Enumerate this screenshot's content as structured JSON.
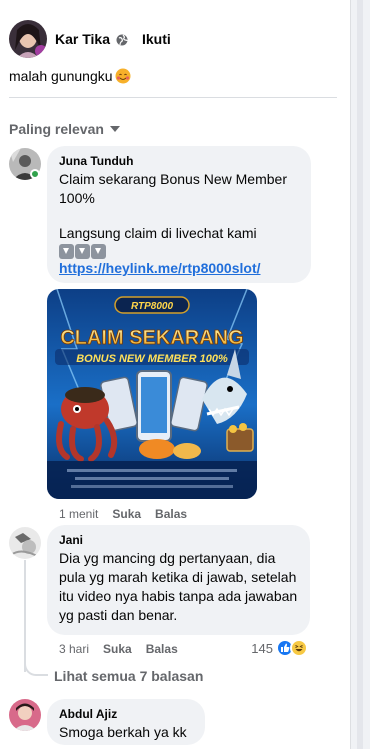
{
  "post": {
    "author": "Kar Tika",
    "follow_label": "Ikuti",
    "text": "malah gunungku",
    "emoji": "smiling-face-with-hearts"
  },
  "sort": {
    "label": "Paling relevan"
  },
  "comments": [
    {
      "author": "Juna Tunduh",
      "lines": [
        "Claim sekarang Bonus New Member 100%",
        "Langsung claim di livechat kami"
      ],
      "link": "https://heylink.me/rtp8000slot/",
      "image": {
        "brand": "RTP8000",
        "headline": "CLAIM SEKARANG",
        "subheadline": "BONUS NEW MEMBER 100%"
      },
      "time": "1 menit",
      "like_label": "Suka",
      "reply_label": "Balas"
    },
    {
      "author": "Jani",
      "text": "Dia yg mancing dg pertanyaan, dia pula yg marah ketika di jawab, setelah itu video nya habis tanpa ada jawaban yg pasti dan benar.",
      "time": "3 hari",
      "like_label": "Suka",
      "reply_label": "Balas",
      "reaction_count": "145",
      "reactions": [
        "like-icon",
        "haha-icon"
      ]
    },
    {
      "author": "Abdul Ajiz",
      "text": "Smoga berkah ya kk"
    }
  ],
  "view_replies": "Lihat semua 7 balasan",
  "colors": {
    "link": "#216fdb",
    "bubble": "#f0f2f5",
    "muted": "#65676b",
    "online": "#31a24c"
  }
}
